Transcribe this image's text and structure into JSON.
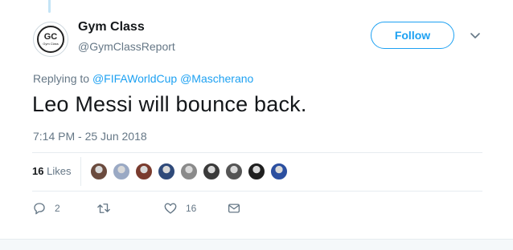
{
  "author": {
    "name": "Gym Class",
    "handle": "@GymClassReport",
    "avatar_text": "GC",
    "avatar_subtext": "Gym Class"
  },
  "follow_label": "Follow",
  "replying": {
    "prefix": "Replying to",
    "mentions": [
      "@FIFAWorldCup",
      "@Mascherano"
    ]
  },
  "tweet": {
    "text": "Leo Messi will bounce back.",
    "timestamp": "7:14 PM - 25 Jun 2018"
  },
  "likes": {
    "count": "16",
    "label": "Likes",
    "likers": [
      {
        "name": "liker-avatar-1",
        "color": "#6b4b3e"
      },
      {
        "name": "liker-avatar-2",
        "color": "#9aa9c4"
      },
      {
        "name": "liker-avatar-3",
        "color": "#7a3b2e"
      },
      {
        "name": "liker-avatar-4",
        "color": "#2f4a7a"
      },
      {
        "name": "liker-avatar-5",
        "color": "#8a8a8a"
      },
      {
        "name": "liker-avatar-6",
        "color": "#3a3a3a"
      },
      {
        "name": "liker-avatar-7",
        "color": "#555555"
      },
      {
        "name": "liker-avatar-8",
        "color": "#1f1f1f"
      },
      {
        "name": "liker-avatar-9",
        "color": "#2b4fa0"
      }
    ]
  },
  "actions": {
    "replies": "2",
    "retweets": "",
    "likes": "16"
  },
  "colors": {
    "accent": "#1da1f2",
    "secondary_text": "#657786",
    "primary_text": "#14171a",
    "divider": "#e6ecf0"
  }
}
